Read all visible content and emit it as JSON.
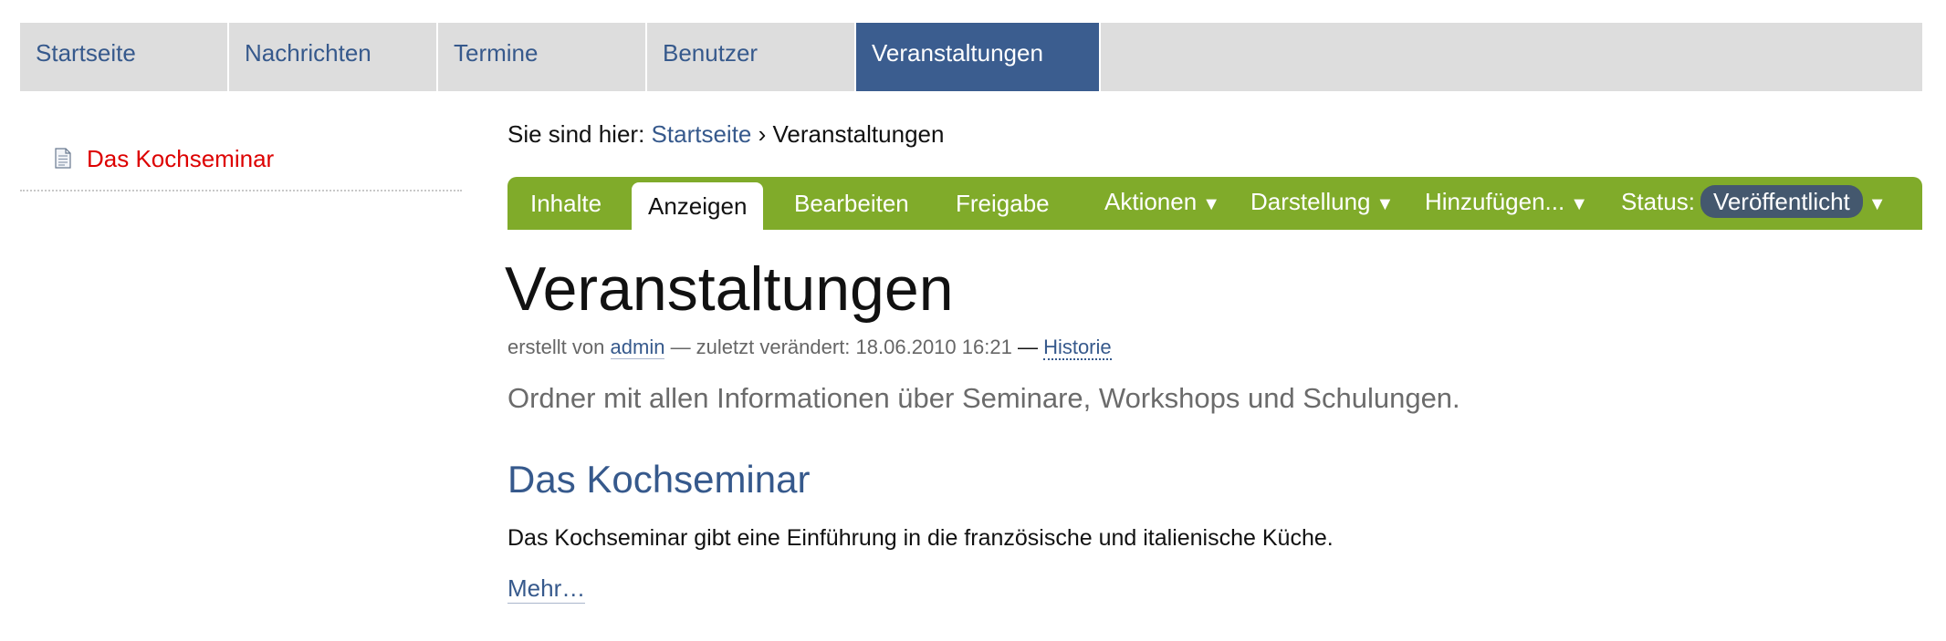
{
  "global_nav": {
    "tabs": [
      {
        "label": "Startseite"
      },
      {
        "label": "Nachrichten"
      },
      {
        "label": "Termine"
      },
      {
        "label": "Benutzer"
      },
      {
        "label": "Veranstaltungen",
        "active": true
      }
    ]
  },
  "portlet": {
    "items": [
      {
        "label": "Das Kochseminar",
        "icon": "document-icon"
      }
    ]
  },
  "breadcrumbs": {
    "prefix": "Sie sind hier:",
    "home": "Startseite",
    "separator": "›",
    "current": "Veranstaltungen"
  },
  "editbar": {
    "tabs": [
      "Inhalte",
      "Anzeigen",
      "Bearbeiten",
      "Freigabe"
    ],
    "active_tab": "Anzeigen",
    "menus": {
      "actions": "Aktionen",
      "display": "Darstellung",
      "add": "Hinzufügen...",
      "status_label": "Status:",
      "status_value": "Veröffentlicht"
    },
    "caret": "▼"
  },
  "content": {
    "title": "Veranstaltungen",
    "byline": {
      "created_by": "erstellt von",
      "author": "admin",
      "modified": "— zuletzt verändert: 18.06.2010 16:21",
      "dash": "—",
      "history": "Historie"
    },
    "description": "Ordner mit allen Informationen über Seminare, Workshops und Schulungen.",
    "items": [
      {
        "title": "Das Kochseminar",
        "description": "Das Kochseminar gibt eine Einführung in die französische und italienische Küche.",
        "more": "Mehr…"
      }
    ]
  },
  "colors": {
    "nav_bg": "#dddddd",
    "nav_active": "#3b5d8f",
    "link": "#36598c",
    "editbar": "#80ab2a",
    "status_pill": "#44586e",
    "portlet_link": "#dd0000"
  }
}
